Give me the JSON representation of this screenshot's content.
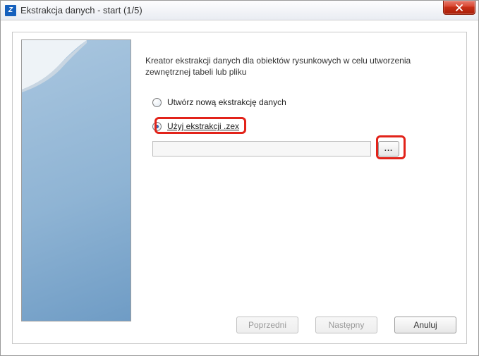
{
  "window": {
    "title": "Ekstrakcja danych - start (1/5)"
  },
  "wizard": {
    "description": "Kreator ekstrakcji danych dla obiektów rysunkowych w celu utworzenia zewnętrznej tabeli lub pliku",
    "option_new": "Utwórz nową ekstrakcję danych",
    "option_use": "Użyj ekstrakcji .zex",
    "path_value": "",
    "browse_label": "...",
    "selected_option": "use"
  },
  "buttons": {
    "prev": "Poprzedni",
    "next": "Następny",
    "cancel": "Anuluj"
  }
}
